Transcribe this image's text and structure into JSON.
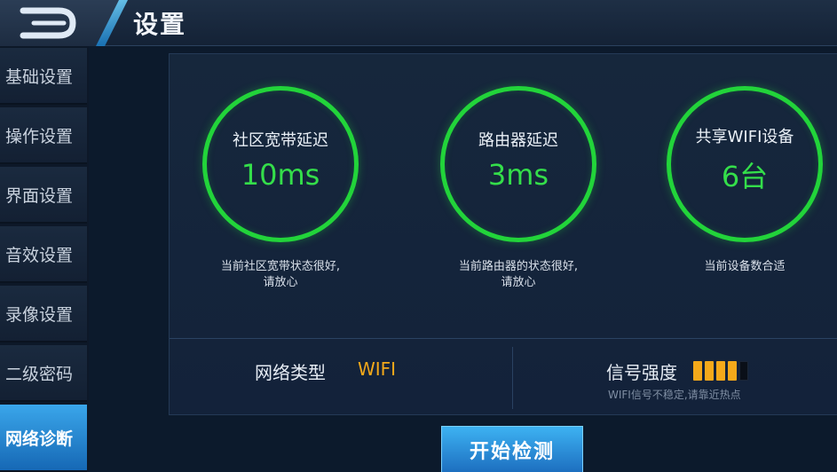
{
  "header": {
    "title": "设置",
    "back_icon": "back-arrow-icon"
  },
  "sidebar": {
    "items": [
      {
        "label": "基础设置",
        "active": false
      },
      {
        "label": "操作设置",
        "active": false
      },
      {
        "label": "界面设置",
        "active": false
      },
      {
        "label": "音效设置",
        "active": false
      },
      {
        "label": "录像设置",
        "active": false
      },
      {
        "label": "二级密码",
        "active": false
      },
      {
        "label": "网络诊断",
        "active": true
      }
    ]
  },
  "diagnostics": {
    "cards": [
      {
        "label": "社区宽带延迟",
        "value": "10ms",
        "note_line1": "当前社区宽带状态很好,",
        "note_line2": "请放心"
      },
      {
        "label": "路由器延迟",
        "value": "3ms",
        "note_line1": "当前路由器的状态很好,",
        "note_line2": "请放心"
      },
      {
        "label": "共享WIFI设备",
        "value": "6台",
        "note_line1": "当前设备数合适",
        "note_line2": ""
      }
    ],
    "network_type_label": "网络类型",
    "network_type_value": "WIFI",
    "signal_label": "信号强度",
    "signal_level": 4,
    "signal_max": 5,
    "signal_note": "WIFI信号不稳定,请靠近热点"
  },
  "actions": {
    "start_label": "开始检测"
  },
  "colors": {
    "ring": "#22d43a",
    "value": "#34de4a",
    "accent_orange": "#f4a91a",
    "active_tab": "#2a8fd8"
  }
}
